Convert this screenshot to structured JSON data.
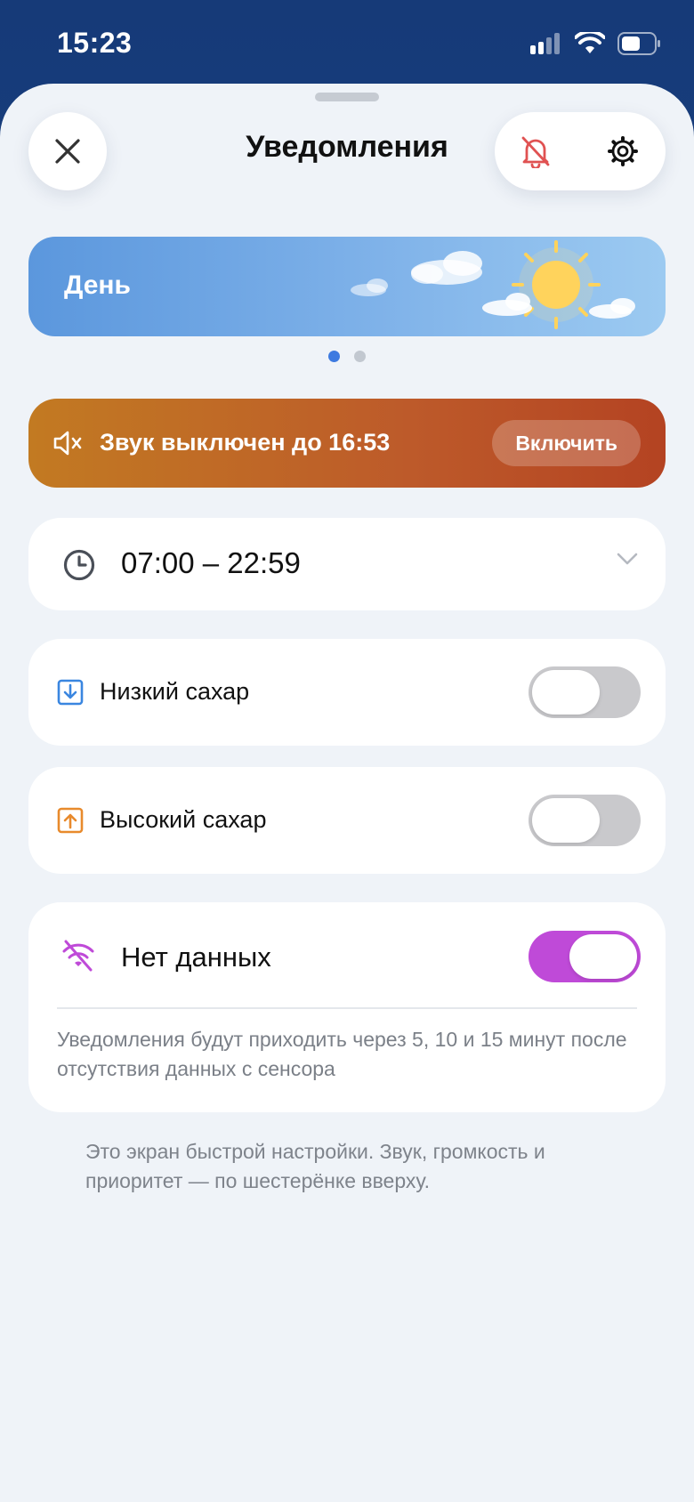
{
  "status_bar": {
    "time": "15:23"
  },
  "header": {
    "title": "Уведомления"
  },
  "mode": {
    "label": "День",
    "pager_count": 2,
    "active_page": 0
  },
  "mute_banner": {
    "text": "Звук выключен до 16:53",
    "button_label": "Включить"
  },
  "schedule": {
    "time_range": "07:00 – 22:59"
  },
  "alerts": {
    "low": {
      "label": "Низкий сахар",
      "enabled": false
    },
    "high": {
      "label": "Высокий сахар",
      "enabled": false
    },
    "no_data": {
      "label": "Нет данных",
      "enabled": true,
      "description": "Уведомления будут приходить через 5, 10 и 15 минут после отсутствия данных с сенсора"
    }
  },
  "footnote": "Это экран быстрой настройки. Звук, громкость и приоритет — по шестерёнке вверху.",
  "colors": {
    "accent": "#3d7ae0",
    "toggle_on": "#bf4ad8",
    "low_icon": "#3a86e0",
    "high_icon": "#e88a2c",
    "mute_icon": "#e05252"
  },
  "icons": {
    "close": "close-icon",
    "mute": "bell-off-icon",
    "settings": "gear-icon",
    "sound_off": "speaker-muted-icon",
    "clock": "clock-icon",
    "chevron": "chevron-down-icon",
    "low": "arrow-down-box-icon",
    "high": "arrow-up-box-icon",
    "no_data": "wifi-off-icon",
    "sun": "sun-icon",
    "cloud": "cloud-icon"
  }
}
